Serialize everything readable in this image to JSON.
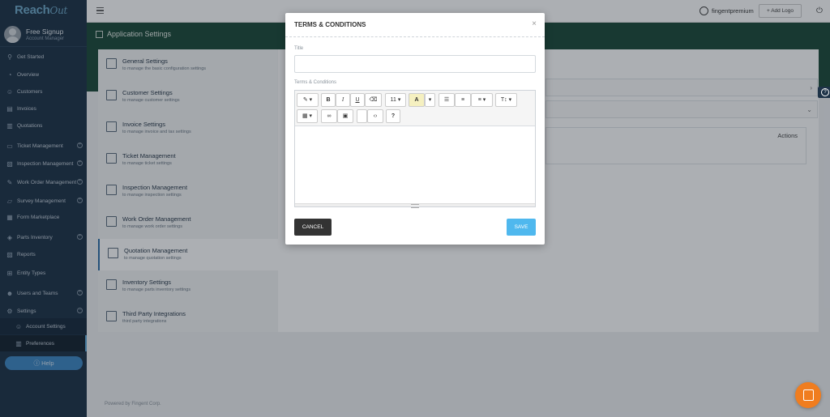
{
  "brand": {
    "name": "Reach",
    "suffix": "Out"
  },
  "profile": {
    "name": "Free Signup",
    "role": "Account Manager"
  },
  "sidebar": {
    "items": [
      {
        "label": "Get Started",
        "icon": "rocket-icon"
      },
      {
        "label": "Overview",
        "icon": "dashboard-icon"
      },
      {
        "label": "Customers",
        "icon": "customers-icon"
      },
      {
        "label": "Invoices",
        "icon": "invoice-icon"
      },
      {
        "label": "Quotations",
        "icon": "quotation-icon"
      },
      {
        "label": "Ticket Management",
        "icon": "ticket-icon",
        "expandable": true
      },
      {
        "label": "Inspection Management",
        "icon": "inspection-icon",
        "expandable": true
      },
      {
        "label": "Work Order Management",
        "icon": "wrench-icon",
        "expandable": true
      },
      {
        "label": "Survey Management",
        "icon": "survey-icon",
        "expandable": true
      },
      {
        "label": "Form Marketplace",
        "icon": "form-icon"
      },
      {
        "label": "Parts Inventory",
        "icon": "box-icon",
        "expandable": true
      },
      {
        "label": "Reports",
        "icon": "reports-icon"
      },
      {
        "label": "Entity Types",
        "icon": "entity-icon"
      },
      {
        "label": "Users and Teams",
        "icon": "users-icon",
        "expandable": true
      },
      {
        "label": "Settings",
        "icon": "gear-icon",
        "expandable": true,
        "expanded": true
      }
    ],
    "sub_items": [
      {
        "label": "Account Settings",
        "icon": "account-settings-icon"
      },
      {
        "label": "Preferences",
        "icon": "sliders-icon",
        "active": true
      }
    ],
    "help_label": "Help"
  },
  "topbar": {
    "user": "fingentpremium",
    "add_logo": "+ Add Logo"
  },
  "page": {
    "title": "Application Settings"
  },
  "settings_menu": [
    {
      "title": "General Settings",
      "subtitle": "to manage the basic configuration settings"
    },
    {
      "title": "Customer Settings",
      "subtitle": "to manage customer settings"
    },
    {
      "title": "Invoice Settings",
      "subtitle": "to manage invoice and tax settings"
    },
    {
      "title": "Ticket Management",
      "subtitle": "to manage ticket settings"
    },
    {
      "title": "Inspection Management",
      "subtitle": "to manage inspection settings"
    },
    {
      "title": "Work Order Management",
      "subtitle": "to manage work order settings"
    },
    {
      "title": "Quotation Management",
      "subtitle": "to manage quotation settings",
      "selected": true
    },
    {
      "title": "Inventory Settings",
      "subtitle": "to manage parts inventory settings"
    },
    {
      "title": "Third Party Integrations",
      "subtitle": "third party integrations"
    }
  ],
  "content": {
    "actions_label": "Actions"
  },
  "footer": {
    "text": "Powered by Fingent Corp."
  },
  "modal": {
    "title": "TERMS & CONDITIONS",
    "close": "×",
    "title_label": "Title",
    "title_value": "",
    "terms_label": "Terms & Conditions",
    "toolbar": {
      "font_size": "11",
      "bold": "B",
      "italic": "I",
      "underline": "U",
      "help": "?"
    },
    "cancel_label": "CANCEL",
    "save_label": "SAVE"
  },
  "colors": {
    "sidebar_bg": "#1e3348",
    "header_bg": "#1d4a3a",
    "save_button": "#4fb8ee",
    "cancel_button": "#333333",
    "chat_bubble": "#f07d1f"
  }
}
